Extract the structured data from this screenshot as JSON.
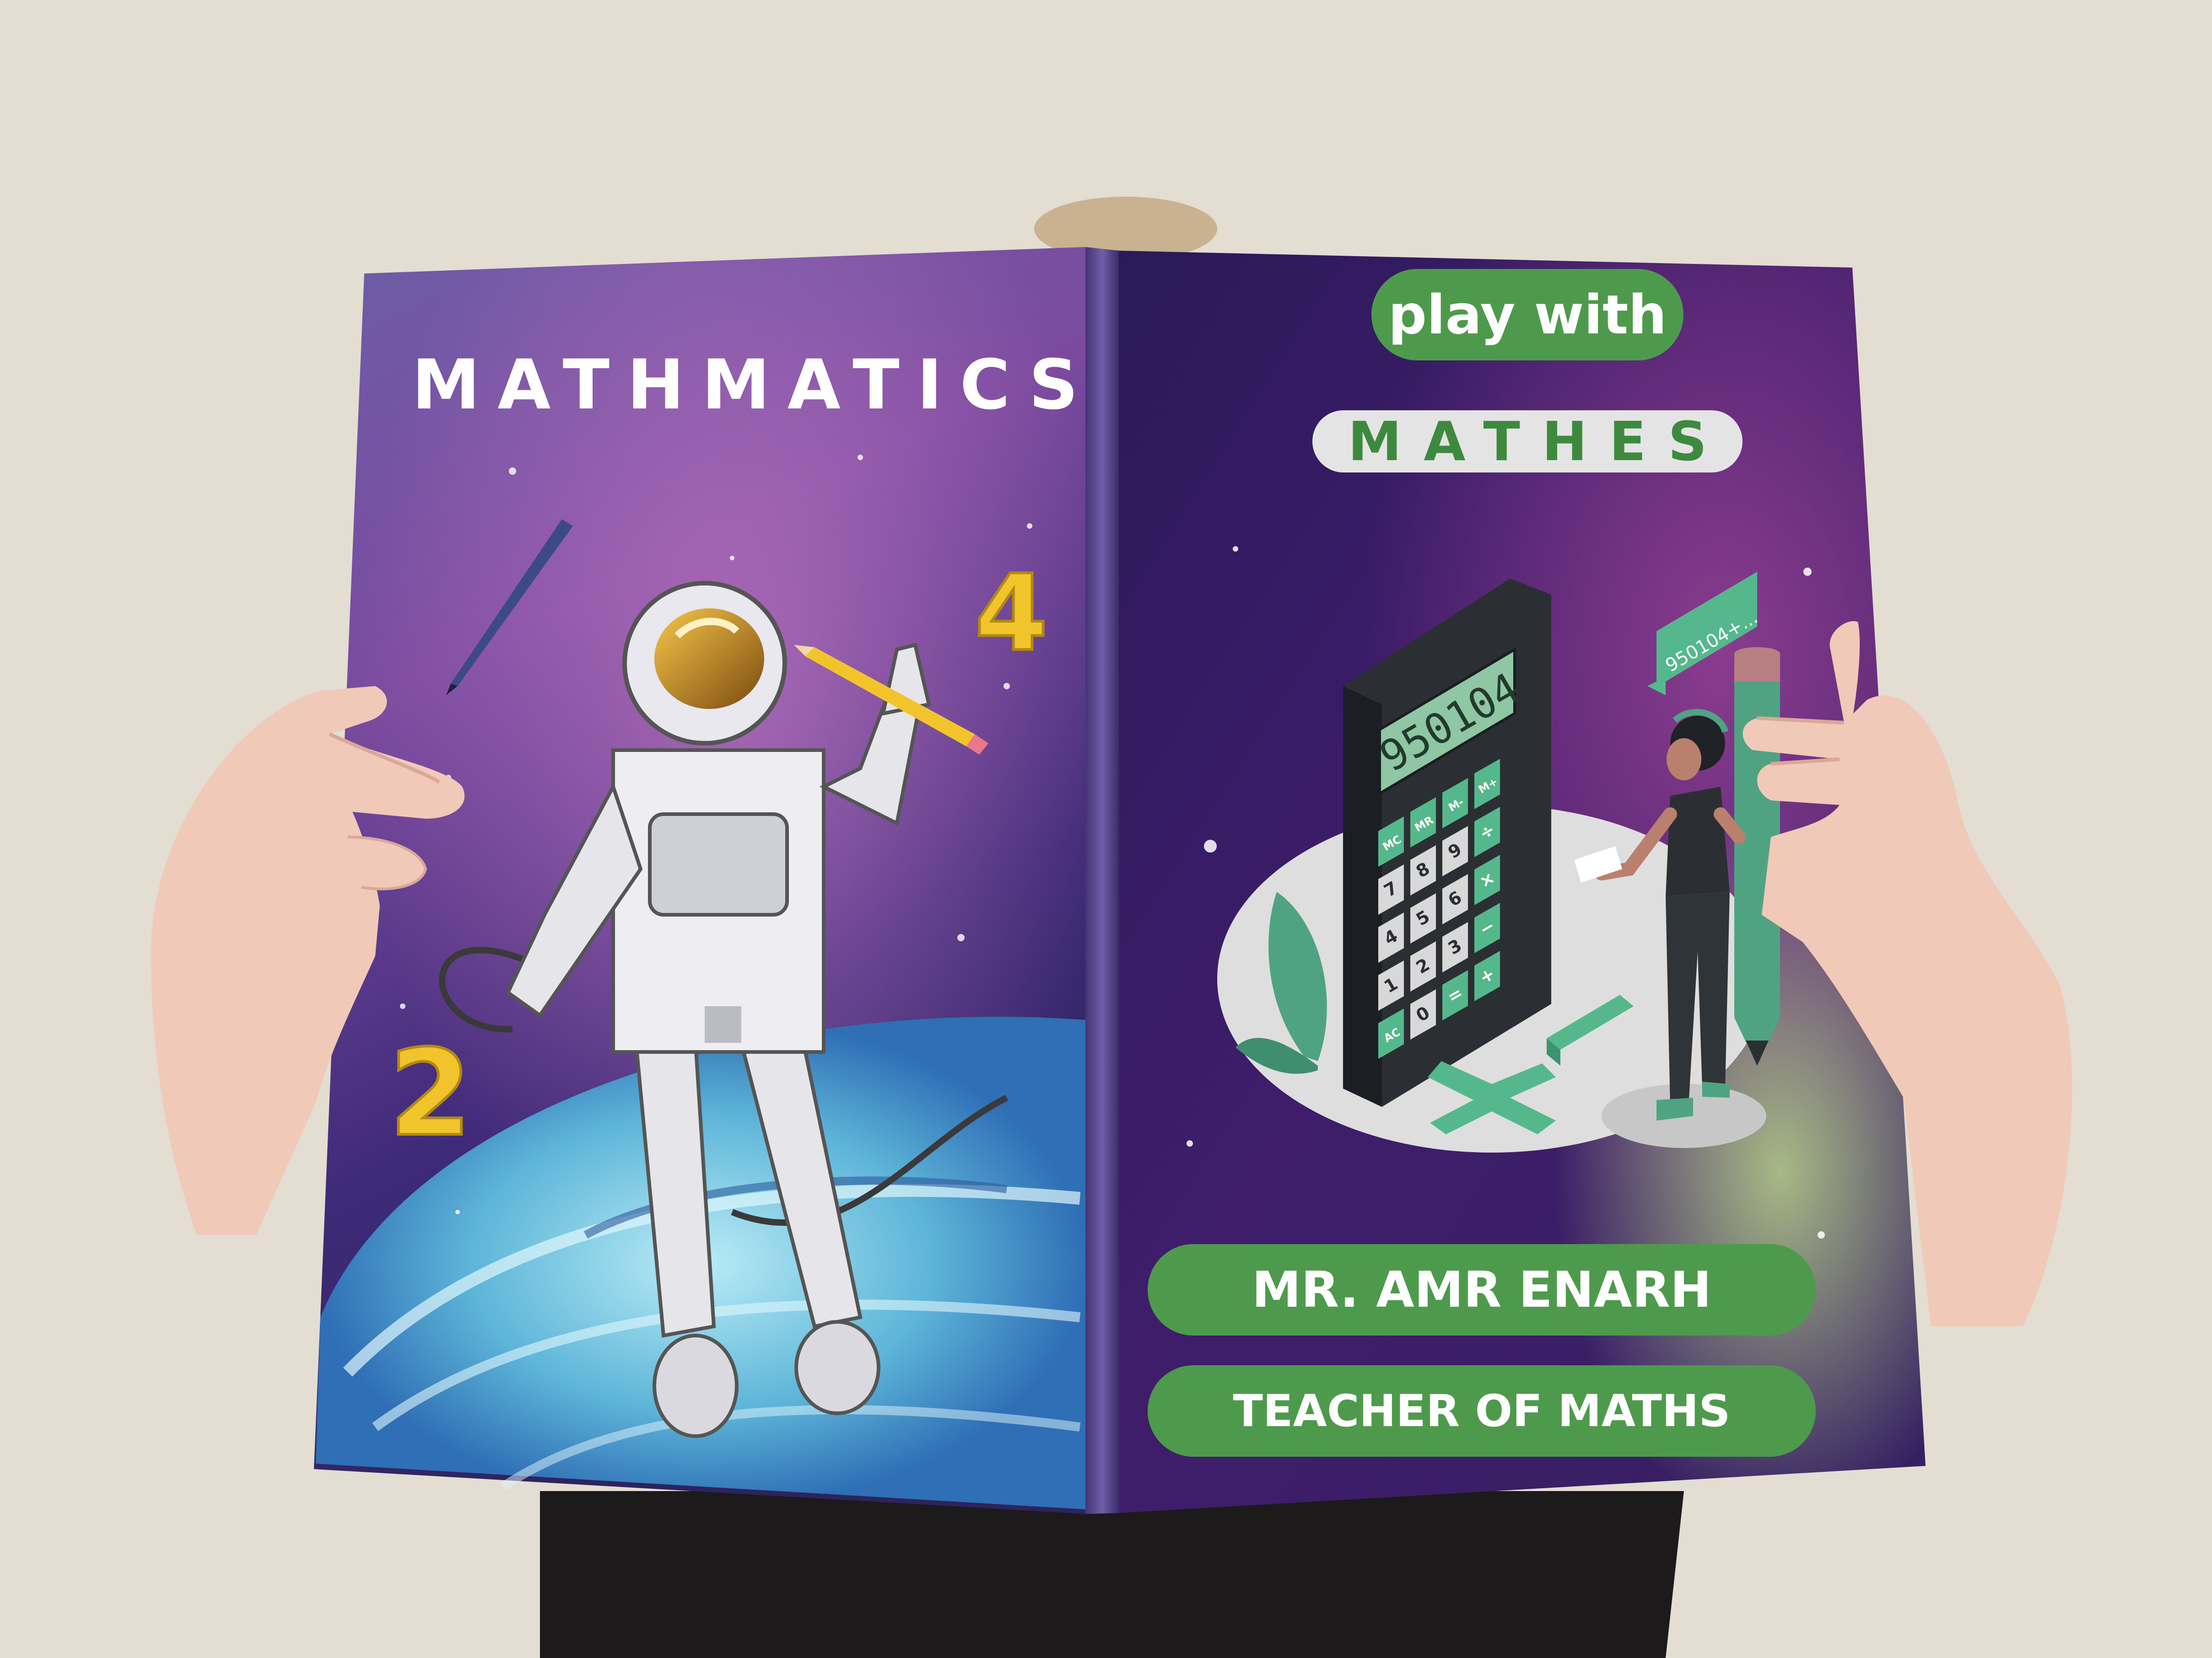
{
  "back_cover": {
    "title": "MATHMATICS",
    "floating_numbers": [
      "4",
      "2"
    ]
  },
  "front_cover": {
    "tagline": "play with",
    "title": "MATHES",
    "calculator_display": "950104",
    "speech_bubble": "950104+...",
    "calculator_keys": [
      "M+",
      "M-",
      "MR",
      "MC",
      "÷",
      "9",
      "8",
      "7",
      "×",
      "6",
      "5",
      "4",
      "−",
      "3",
      "2",
      "1",
      "+",
      "=",
      "0",
      "AC"
    ],
    "author": "MR. AMR ENARH",
    "author_role": "TEACHER OF MATHS"
  },
  "colors": {
    "background_wall": "#e3ddd2",
    "cover_purple": "#3d1f66",
    "accent_green": "#4e9a4c",
    "number_yellow": "#f2c42b",
    "skin": "#f0c9b8"
  }
}
